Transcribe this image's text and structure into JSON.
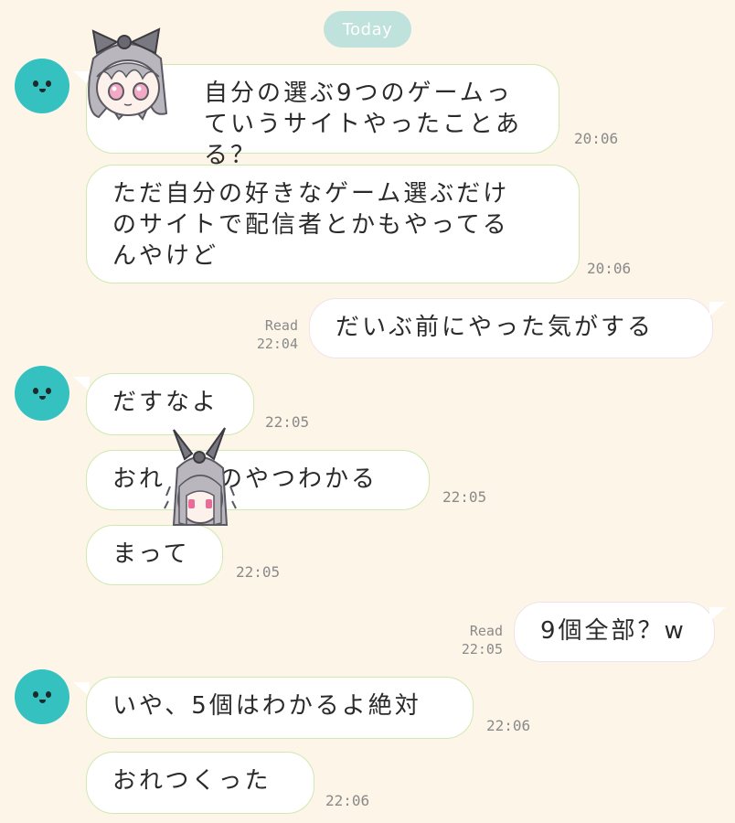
{
  "date_label": "Today",
  "messages": [
    {
      "side": "left",
      "text": "自分の選ぶ9つのゲームっ\nていうサイトやったことある？",
      "time": "20:06"
    },
    {
      "side": "left",
      "text": "ただ自分の好きなゲーム選ぶだけ\nのサイトで配信者とかもやってる\nんやけど",
      "time": "20:06"
    },
    {
      "side": "right",
      "text": "だいぶ前にやった気がする",
      "read": "Read",
      "time": "22:04"
    },
    {
      "side": "left",
      "text": "だすなよ",
      "time": "22:05"
    },
    {
      "side": "left",
      "text": "おれ　　のやつわかる",
      "time": "22:05"
    },
    {
      "side": "left",
      "text": "まって",
      "time": "22:05"
    },
    {
      "side": "right",
      "text": "9個全部？w",
      "read": "Read",
      "time": "22:05"
    },
    {
      "side": "left",
      "text": "いや、5個はわかるよ絶対",
      "time": "22:06"
    },
    {
      "side": "left",
      "text": "おれつくった",
      "time": "22:06"
    }
  ],
  "colors": {
    "background": "#fcf5e8",
    "avatar": "#35c1bf",
    "date_pill": "#bfe3dc"
  },
  "icons": [
    "seal-avatar-icon",
    "chibi-girl-sticker",
    "chibi-girl-peek-sticker"
  ]
}
